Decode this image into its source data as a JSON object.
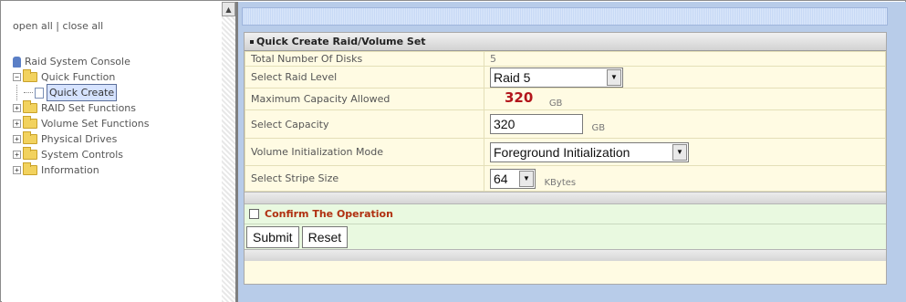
{
  "nav": {
    "open_all": "open all",
    "separator": " | ",
    "close_all": "close all"
  },
  "tree": {
    "root": "Raid System Console",
    "quick_function": "Quick Function",
    "quick_create": "Quick Create",
    "raid_set_functions": "RAID Set Functions",
    "volume_set_functions": "Volume Set Functions",
    "physical_drives": "Physical Drives",
    "system_controls": "System Controls",
    "information": "Information"
  },
  "panel": {
    "title": "Quick Create Raid/Volume Set",
    "rows": {
      "disks_label": "Total Number Of Disks",
      "disks_value": "5",
      "raid_label": "Select Raid Level",
      "raid_value": "Raid 5",
      "maxcap_label": "Maximum Capacity Allowed",
      "maxcap_value": "320",
      "maxcap_unit": "GB",
      "capacity_label": "Select Capacity",
      "capacity_value": "320",
      "capacity_unit": "GB",
      "init_label": "Volume Initialization Mode",
      "init_value": "Foreground Initialization",
      "stripe_label": "Select Stripe Size",
      "stripe_value": "64",
      "stripe_unit": "KBytes"
    },
    "confirm_label": "Confirm The Operation",
    "submit": "Submit",
    "reset": "Reset"
  },
  "colors": {
    "panel_bg": "#fffbe3",
    "confirm_bg": "#e9f9e0",
    "confirm_text": "#b03010",
    "maxcap_text": "#b3151b",
    "right_bg": "#b8cce9"
  },
  "icons": {
    "expand": "plus-box-icon",
    "collapse": "minus-box-icon",
    "folder": "folder-icon",
    "page": "page-icon",
    "scroll_up": "triangle-up-icon",
    "dropdown": "triangle-down-icon"
  }
}
